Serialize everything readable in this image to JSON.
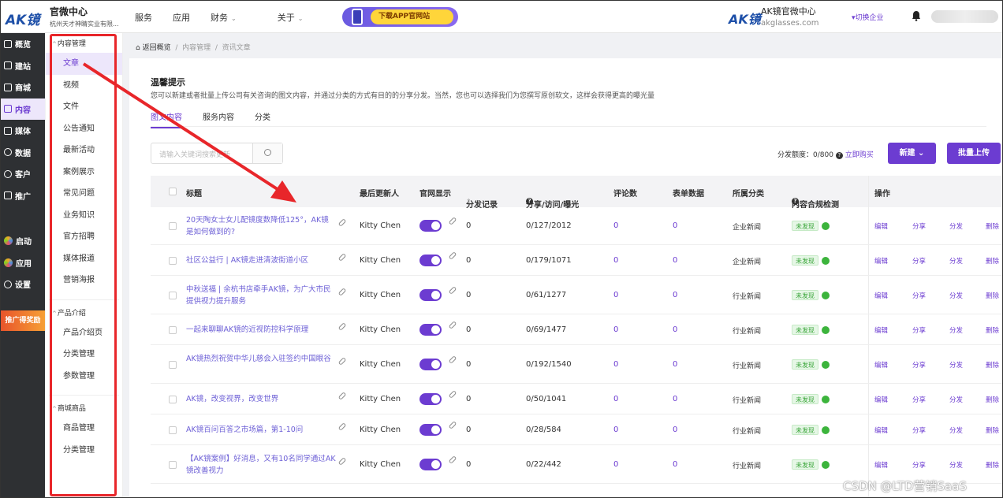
{
  "topbar": {
    "logo": "AK镜",
    "brand_title": "官微中心",
    "brand_sub": "杭州天才神睛实业有限...",
    "nav": [
      "服务",
      "应用",
      "财务",
      "关于"
    ],
    "banner_text": "下载APP官网站",
    "right_logo": "AK镜",
    "right_title": "AK镜官微中心",
    "right_sub": "akglasses.com",
    "switch_label": "切换企业"
  },
  "rail": {
    "items": [
      {
        "label": "概览",
        "icon": "overview-icon",
        "active": false
      },
      {
        "label": "建站",
        "icon": "home-icon",
        "active": false
      },
      {
        "label": "商城",
        "icon": "shop-icon",
        "active": false
      },
      {
        "label": "内容",
        "icon": "content-icon",
        "active": true
      },
      {
        "label": "媒体",
        "icon": "media-icon",
        "active": false
      },
      {
        "label": "数据",
        "icon": "data-icon",
        "active": false
      },
      {
        "label": "客户",
        "icon": "user-icon",
        "active": false
      },
      {
        "label": "推广",
        "icon": "promote-icon",
        "active": false
      }
    ],
    "bottom": [
      {
        "label": "启动",
        "icon": "launch-icon"
      },
      {
        "label": "应用",
        "icon": "apps-icon"
      },
      {
        "label": "设置",
        "icon": "settings-icon"
      }
    ],
    "promo": "推广得奖励"
  },
  "submenu": {
    "groups": [
      {
        "label": "内容管理",
        "items": [
          "文章",
          "视频",
          "文件",
          "公告通知",
          "最新活动",
          "案例展示",
          "常见问题",
          "业务知识",
          "官方招聘",
          "媒体报道",
          "营销海报"
        ]
      },
      {
        "label": "产品介绍",
        "items": [
          "产品介绍页",
          "分类管理",
          "参数管理"
        ]
      },
      {
        "label": "商城商品",
        "items": [
          "商品管理",
          "分类管理"
        ]
      }
    ]
  },
  "breadcrumb": {
    "back": "返回概览",
    "level1": "内容管理",
    "level2": "资讯文章"
  },
  "tip": {
    "title": "温馨提示",
    "desc": "您可以新建或者批量上传公司有关咨询的图文内容，并通过分类的方式有目的的分享分发。当然，您也可以选择我们为您撰写原创软文，这样会获得更高的曝光量"
  },
  "tabs": [
    "图文内容",
    "服务内容",
    "分类"
  ],
  "search": {
    "placeholder": "请输入关键词搜索更新"
  },
  "quota": {
    "label": "分发额度：0/800",
    "buy": "立即购买"
  },
  "buttons": {
    "new": "新建",
    "batch": "批量上传"
  },
  "table": {
    "headers": {
      "title": "标题",
      "updater": "最后更新人",
      "site": "官网显示",
      "dist": "分发记录",
      "share": "分享/访问/曝光",
      "comments": "评论数",
      "forms": "表单数据",
      "category": "所属分类",
      "check": "内容合规检测",
      "ops": "操作"
    },
    "op_labels": {
      "edit": "编辑",
      "share": "分享",
      "dist": "分发",
      "del": "删除"
    },
    "rows": [
      {
        "title": "20天陶女士女儿配镜度数降低125°，AK镜是如何做到的?",
        "updater": "Kitty Chen",
        "site_on": true,
        "dist": "0",
        "share": "0/127/2012",
        "comments": "0",
        "forms": "0",
        "category": "企业新闻",
        "check": "未发现"
      },
      {
        "title": "社区公益行 | AK镜走进清波街道小区",
        "updater": "Kitty Chen",
        "site_on": true,
        "dist": "0",
        "share": "0/179/1071",
        "comments": "0",
        "forms": "0",
        "category": "企业新闻",
        "check": "未发现"
      },
      {
        "title": "中秋送福 | 余杭书店牵手AK镜，为广大市民提供视力提升服务",
        "updater": "Kitty Chen",
        "site_on": true,
        "dist": "0",
        "share": "0/61/1277",
        "comments": "0",
        "forms": "0",
        "category": "行业新闻",
        "check": "未发现"
      },
      {
        "title": "一起来聊聊AK镜的近视防控科学原理",
        "updater": "Kitty Chen",
        "site_on": true,
        "dist": "0",
        "share": "0/69/1477",
        "comments": "0",
        "forms": "0",
        "category": "行业新闻",
        "check": "未发现"
      },
      {
        "title": "AK镜热烈祝贺中华儿慈会入驻签约中国眼谷",
        "updater": "Kitty Chen",
        "site_on": true,
        "dist": "0",
        "share": "0/192/1540",
        "comments": "0",
        "forms": "0",
        "category": "行业新闻",
        "check": "未发现"
      },
      {
        "title": "AK镜，改变视界，改变世界",
        "updater": "Kitty Chen",
        "site_on": true,
        "dist": "0",
        "share": "0/50/1041",
        "comments": "0",
        "forms": "0",
        "category": "行业新闻",
        "check": "未发现"
      },
      {
        "title": "AK镜百问百答之市场篇，第1-10问",
        "updater": "Kitty Chen",
        "site_on": true,
        "dist": "0",
        "share": "0/28/584",
        "comments": "0",
        "forms": "0",
        "category": "行业新闻",
        "check": "未发现"
      },
      {
        "title": "【AK镜案例】好消息，又有10名同学通过AK镜改善视力",
        "updater": "Kitty Chen",
        "site_on": true,
        "dist": "0",
        "share": "0/22/442",
        "comments": "0",
        "forms": "0",
        "category": "行业新闻",
        "check": "未发现"
      }
    ]
  },
  "watermark": "CSDN @LTD营销SaaS",
  "colors": {
    "accent": "#6c3cd1",
    "rail": "#2e3033",
    "annotation": "#e8262a",
    "ok": "#3cb43c"
  }
}
